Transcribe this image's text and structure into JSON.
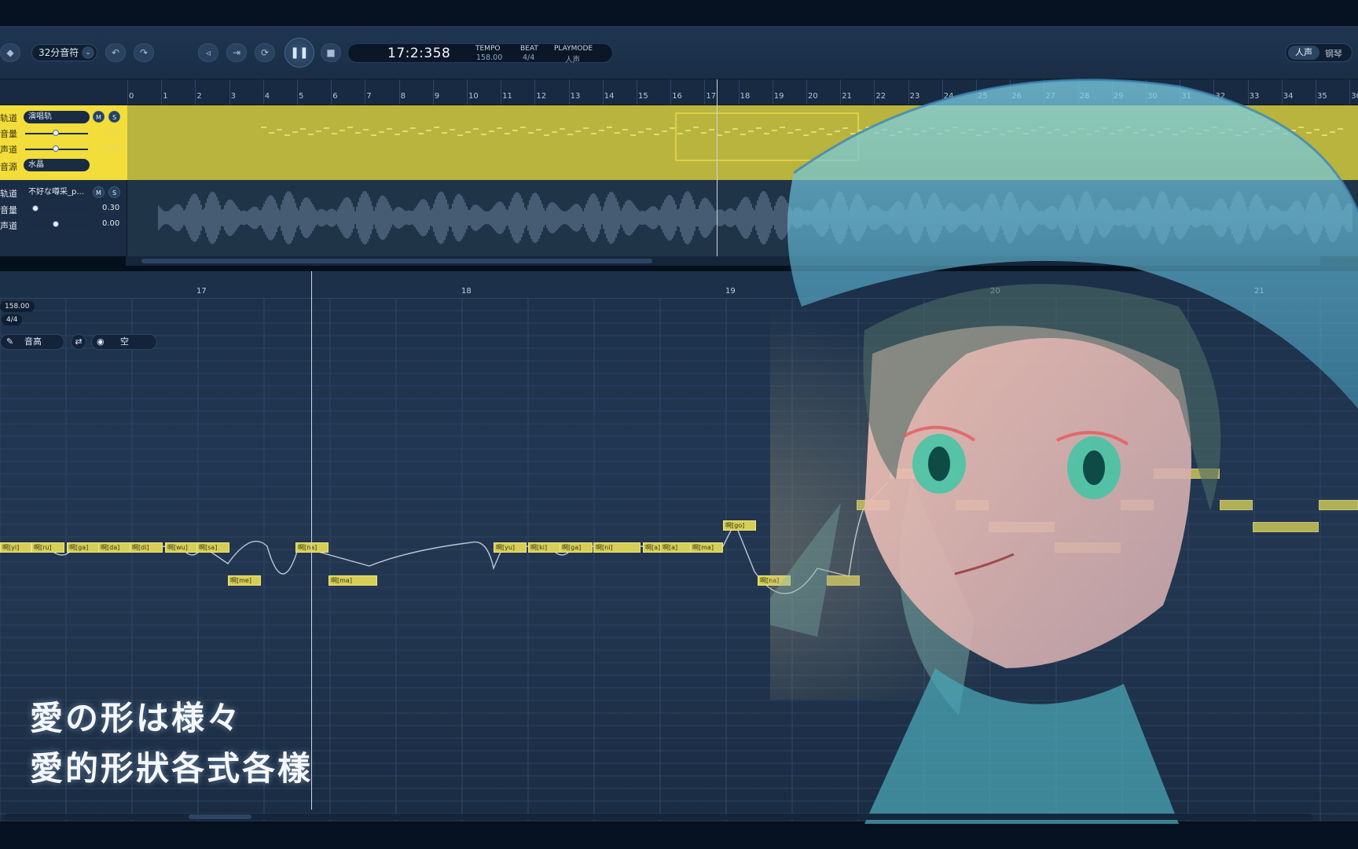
{
  "toolbar": {
    "note_value": "32分音符",
    "time": "17:2:358",
    "tempo_label": "TEMPO",
    "tempo_value": "158.00",
    "beat_label": "BEAT",
    "beat_value": "4/4",
    "playmode_label": "PLAYMODE",
    "playmode_value": "人声",
    "mode_options": [
      "人声",
      "钢琴"
    ]
  },
  "ruler": {
    "bars": [
      "0",
      "1",
      "2",
      "3",
      "4",
      "5",
      "6",
      "7",
      "8",
      "9",
      "10",
      "11",
      "12",
      "13",
      "14",
      "15",
      "16",
      "17",
      "18",
      "19",
      "20",
      "21",
      "22",
      "23",
      "24",
      "25",
      "26",
      "27",
      "28",
      "29",
      "30",
      "31",
      "32",
      "33",
      "34",
      "35",
      "36"
    ]
  },
  "tracks": [
    {
      "name_label": "轨道",
      "name": "演唱轨",
      "volume_label": "音量",
      "volume": "1.00",
      "pan_label": "声道",
      "pan": "0.00",
      "voice_label": "音源",
      "voice": "水晶",
      "mute": "M",
      "solo": "S"
    },
    {
      "name_label": "轨道",
      "name": "不好な噂采_p...",
      "volume_label": "音量",
      "volume": "0.30",
      "pan_label": "声道",
      "pan": "0.00",
      "mute": "M",
      "solo": "S"
    }
  ],
  "editor": {
    "bars": [
      "17",
      "18",
      "19",
      "20",
      "21"
    ],
    "tempo_tag": "158.00",
    "beat_tag": "4/4",
    "param_tool": "音高",
    "view_tool": "空",
    "notes": [
      "啊[yi]",
      "啊[ru]",
      "啊[ga]",
      "啊[da]",
      "啊[di]",
      "啊[wu]",
      "啊[sa]",
      "啊[me]",
      "啊[na]",
      "啊[ma]",
      "啊[yu]",
      "啊[ki]",
      "啊[ga]",
      "啊[ni]",
      "啊[a]",
      "啊[a]",
      "啊[ma]",
      "啊[go]",
      "啊[na]"
    ]
  },
  "lyrics": {
    "line1": "愛の形は様々",
    "line2": "愛的形狀各式各樣"
  },
  "colors": {
    "accent_yellow": "#f2dd3a",
    "background": "#1c3048"
  }
}
